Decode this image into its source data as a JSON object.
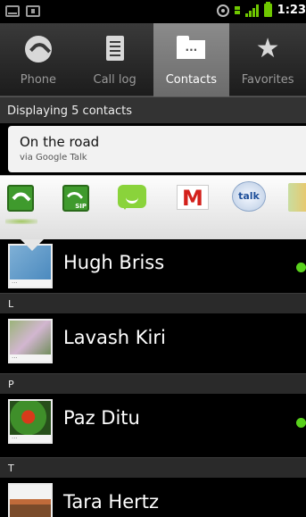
{
  "status_bar": {
    "time": "1:23",
    "icons": [
      "mail-icon",
      "square-notification-icon",
      "gps-icon",
      "network-icon",
      "signal-icon",
      "battery-icon"
    ]
  },
  "tabs": [
    {
      "label": "Phone",
      "icon": "phone-icon",
      "active": false
    },
    {
      "label": "Call log",
      "icon": "call-log-icon",
      "active": false
    },
    {
      "label": "Contacts",
      "icon": "contacts-folder-icon",
      "active": true
    },
    {
      "label": "Favorites",
      "icon": "star-icon",
      "active": false
    }
  ],
  "contacts_count_text": "Displaying 5 contacts",
  "status_card": {
    "status": "On the road",
    "source": "via Google Talk"
  },
  "quick_actions": [
    "phone-call-icon",
    "sip-call-icon",
    "sms-icon",
    "gmail-icon",
    "talk-icon",
    "maps-icon"
  ],
  "quick_action_labels": {
    "gmail": "M",
    "talk": "talk"
  },
  "photo_label": "···",
  "contacts": [
    {
      "name": "Hugh Briss",
      "online": true
    },
    {
      "section": "L"
    },
    {
      "name": "Lavash Kiri",
      "online": false
    },
    {
      "section": "P"
    },
    {
      "name": "Paz Ditu",
      "online": true
    },
    {
      "section": "T"
    },
    {
      "name": "Tara Hertz",
      "online": false
    }
  ],
  "colors": {
    "presence_online": "#59d11c",
    "active_tab": "#7a7a7a"
  }
}
